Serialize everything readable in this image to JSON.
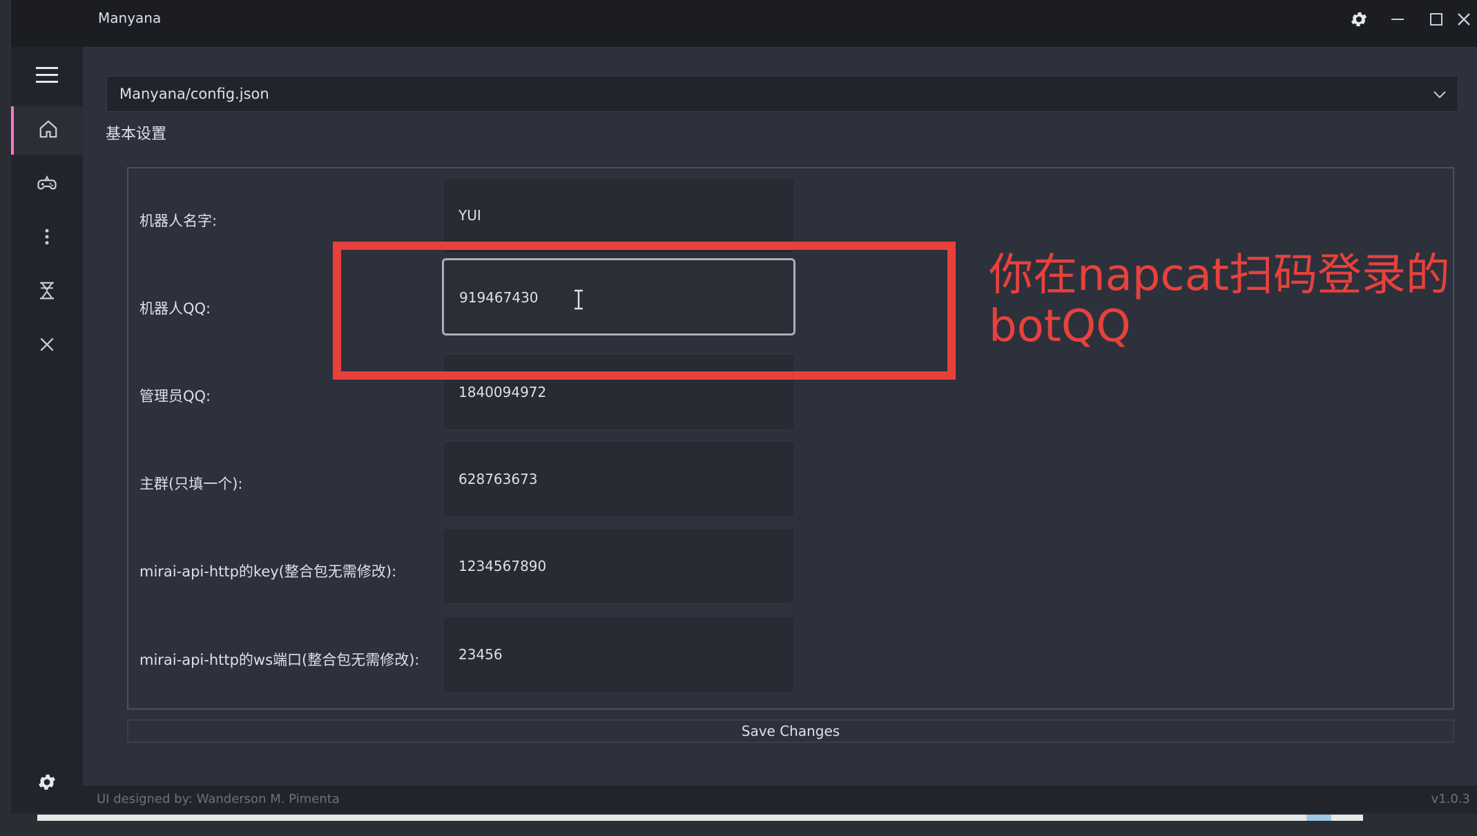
{
  "window": {
    "title": "Manyana"
  },
  "file_selector": {
    "value": "Manyana/config.json"
  },
  "section": {
    "title": "基本设置"
  },
  "form": {
    "rows": [
      {
        "label": "机器人名字:",
        "value": "YUI"
      },
      {
        "label": "机器人QQ:",
        "value": "919467430"
      },
      {
        "label": "管理员QQ:",
        "value": "1840094972"
      },
      {
        "label": "主群(只填一个):",
        "value": "628763673"
      },
      {
        "label": "mirai-api-http的key(整合包无需修改):",
        "value": "1234567890"
      },
      {
        "label": "mirai-api-http的ws端口(整合包无需修改):",
        "value": "23456"
      }
    ]
  },
  "save_button": {
    "label": "Save Changes"
  },
  "footer": {
    "credit": "UI designed by: Wanderson M. Pimenta",
    "version": "v1.0.3"
  },
  "annotation": {
    "text": "你在napcat扫码登录的\nbotQQ",
    "color": "#e8413c"
  },
  "sidebar": {
    "items": [
      {
        "icon": "menu-icon"
      },
      {
        "icon": "home-icon",
        "active": true
      },
      {
        "icon": "gamepad-icon"
      },
      {
        "icon": "more-vertical-icon"
      },
      {
        "icon": "hourglass-icon"
      },
      {
        "icon": "close-icon"
      }
    ],
    "bottom_icon": "gear-icon"
  },
  "colors": {
    "accent": "#ff79c6",
    "background": "#2c313c",
    "sidebar": "#21252b"
  }
}
